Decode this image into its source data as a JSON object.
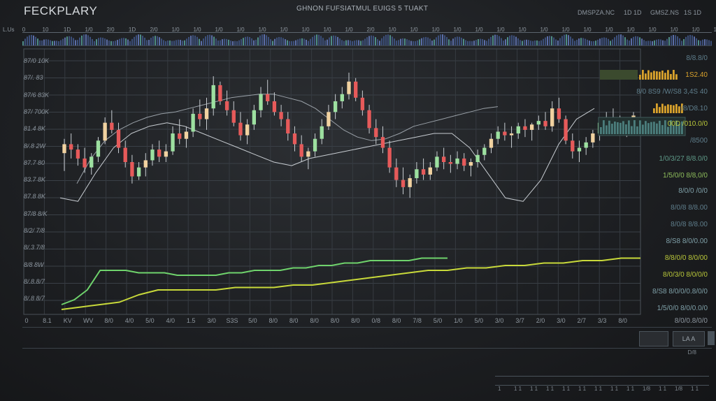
{
  "header": {
    "app_title": "FECKPLARY",
    "chart_title": "GHNON FUFSIATMUL EUIGS 5 TUAKT",
    "buttons": [
      "DMSPZA.NC",
      "1D 1D",
      "GMSZ.NS",
      "1S 1D"
    ],
    "left_tag": "L.Us"
  },
  "ruler_labels": [
    "0",
    "10",
    "1D",
    "1/0",
    "2/0",
    "1D",
    "2/0",
    "1/0",
    "1/0",
    "1/0",
    "1/0",
    "1/0",
    "1/0",
    "1/0",
    "1/0",
    "1/0",
    "2/0",
    "1/0",
    "1/0",
    "1/0",
    "1/0",
    "1/0",
    "1/0",
    "1/0",
    "1/0",
    "1/0",
    "1/0",
    "1/0",
    "1/0",
    "1/0",
    "1/0",
    "1/0",
    "1/0"
  ],
  "y_labels": [
    "87/0 10K",
    "87/. 83",
    "87/6 83K",
    "87/ 700K",
    "81.4 8K",
    "8/.8 2W",
    "87.7 80",
    "83.7 8K",
    "87.8 8K",
    "87/8 8/K",
    "8/2/ 7/8",
    "8/.3 7/8",
    "8/8 8W",
    "8/.8.8/7",
    "8/.8 8/7"
  ],
  "right_labels": [
    "8/8.8/0",
    "1S2.40",
    "8/0 8S9 /W/S8 3,4S 40",
    "/8/D8.10",
    "00D /010.0/0",
    "/8500",
    "1/0/3/27 8/8.0/0",
    "1/5/0/0 8/8,0/0",
    "8/0/0 /0/0",
    "8/0/8 8/8.00",
    "8/0/8 8/8.00",
    "8/S8 8/0/0.00",
    "8/8/0/0 8/0/00",
    "8/0/3/0 8/0/0/0",
    "8/S8 8/0/0/0.8/0/0",
    "1/5/0/0 8/0/0.0/0",
    "8/0/0.8/0/0"
  ],
  "x_labels": [
    "0",
    "8.1",
    "KV",
    "WV",
    "8/0",
    "4/0",
    "5/0",
    "4/0",
    "1.5",
    "3/0",
    "S3S",
    "5/0",
    "8/0",
    "8/0",
    "8/0",
    "8/0",
    "8/0",
    "0/8",
    "8/0",
    "7/8",
    "5/0",
    "1/0",
    "5/0",
    "3/0",
    "3/7",
    "2/0",
    "3/0",
    "2/7",
    "3/3",
    "8/0"
  ],
  "footer": {
    "nav_value": "LA A",
    "small_text": "D/8",
    "tick_numbers": [
      "1",
      "1 1",
      "1 1",
      "1 1",
      "1 1",
      "1 1",
      "1 1",
      "1 1",
      "1 1",
      "1/8",
      "1 1",
      "1/8",
      "1 1"
    ]
  },
  "colors": {
    "bullish": "#9de0a0",
    "bearish": "#e65a5a",
    "neutral": "#f1d2a0",
    "ma_fast": "#c7ccd1",
    "ma_slow": "#9aa1a8",
    "volume_line": "#6fd36c",
    "trend_line": "#c8d93a",
    "accent_bars": "#d9a22c"
  },
  "chart_data": {
    "type": "candlestick",
    "title": "GHNON FUFSIATMUL EUIGS 5 TUAKT",
    "xlabel": "",
    "ylabel": "",
    "ylim": [
      0,
      100
    ],
    "grid": true,
    "ohlc": [
      [
        55,
        63,
        45,
        60
      ],
      [
        60,
        66,
        52,
        57
      ],
      [
        57,
        60,
        48,
        52
      ],
      [
        52,
        58,
        44,
        47
      ],
      [
        47,
        55,
        43,
        53
      ],
      [
        53,
        64,
        50,
        62
      ],
      [
        62,
        75,
        60,
        72
      ],
      [
        72,
        79,
        66,
        68
      ],
      [
        68,
        72,
        55,
        58
      ],
      [
        58,
        62,
        47,
        50
      ],
      [
        50,
        54,
        38,
        42
      ],
      [
        42,
        50,
        40,
        47
      ],
      [
        47,
        55,
        42,
        51
      ],
      [
        51,
        60,
        48,
        57
      ],
      [
        57,
        62,
        50,
        53
      ],
      [
        53,
        60,
        50,
        56
      ],
      [
        56,
        70,
        54,
        66
      ],
      [
        66,
        74,
        60,
        63
      ],
      [
        63,
        70,
        58,
        67
      ],
      [
        67,
        80,
        64,
        77
      ],
      [
        77,
        85,
        70,
        74
      ],
      [
        74,
        86,
        68,
        80
      ],
      [
        80,
        98,
        76,
        93
      ],
      [
        93,
        95,
        82,
        84
      ],
      [
        84,
        90,
        76,
        79
      ],
      [
        79,
        84,
        70,
        72
      ],
      [
        72,
        78,
        62,
        65
      ],
      [
        65,
        74,
        60,
        71
      ],
      [
        71,
        82,
        68,
        79
      ],
      [
        79,
        92,
        75,
        88
      ],
      [
        88,
        96,
        82,
        84
      ],
      [
        84,
        89,
        76,
        78
      ],
      [
        78,
        82,
        70,
        74
      ],
      [
        74,
        78,
        62,
        66
      ],
      [
        66,
        70,
        56,
        60
      ],
      [
        60,
        65,
        50,
        53
      ],
      [
        53,
        58,
        46,
        56
      ],
      [
        56,
        66,
        53,
        63
      ],
      [
        63,
        74,
        60,
        70
      ],
      [
        70,
        82,
        68,
        78
      ],
      [
        78,
        88,
        74,
        84
      ],
      [
        84,
        92,
        80,
        88
      ],
      [
        88,
        100,
        85,
        95
      ],
      [
        95,
        97,
        84,
        86
      ],
      [
        86,
        90,
        76,
        79
      ],
      [
        79,
        82,
        66,
        69
      ],
      [
        69,
        74,
        60,
        64
      ],
      [
        64,
        70,
        55,
        58
      ],
      [
        58,
        62,
        44,
        47
      ],
      [
        47,
        52,
        36,
        40
      ],
      [
        40,
        47,
        32,
        36
      ],
      [
        36,
        43,
        30,
        41
      ],
      [
        41,
        50,
        38,
        46
      ],
      [
        46,
        52,
        40,
        43
      ],
      [
        43,
        50,
        40,
        47
      ],
      [
        47,
        56,
        45,
        53
      ],
      [
        53,
        58,
        46,
        50
      ],
      [
        50,
        54,
        44,
        49
      ],
      [
        49,
        56,
        46,
        52
      ],
      [
        52,
        55,
        45,
        48
      ],
      [
        48,
        52,
        42,
        50
      ],
      [
        50,
        57,
        47,
        54
      ],
      [
        54,
        60,
        51,
        58
      ],
      [
        58,
        66,
        55,
        63
      ],
      [
        63,
        70,
        60,
        67
      ],
      [
        67,
        72,
        62,
        65
      ],
      [
        65,
        70,
        58,
        66
      ],
      [
        66,
        72,
        63,
        70
      ],
      [
        70,
        74,
        64,
        68
      ],
      [
        68,
        72,
        62,
        71
      ],
      [
        71,
        76,
        68,
        73
      ],
      [
        73,
        78,
        68,
        70
      ],
      [
        70,
        84,
        67,
        80
      ],
      [
        80,
        86,
        72,
        74
      ],
      [
        74,
        76,
        60,
        62
      ],
      [
        62,
        66,
        52,
        56
      ],
      [
        56,
        62,
        50,
        58
      ],
      [
        58,
        64,
        54,
        61
      ],
      [
        61,
        68,
        58,
        66
      ],
      [
        66,
        74,
        62,
        72
      ],
      [
        72,
        78,
        68,
        75
      ],
      [
        75,
        80,
        70,
        73
      ],
      [
        73,
        76,
        66,
        70
      ],
      [
        70,
        74,
        64,
        72
      ],
      [
        72,
        78,
        69,
        76
      ]
    ],
    "series": [
      {
        "values": [
          38,
          52,
          62,
          68,
          72,
          75,
          77,
          78,
          80,
          82,
          84,
          86,
          87,
          88,
          88,
          86,
          84,
          80,
          74,
          68,
          64,
          62,
          63,
          66,
          70,
          72,
          74,
          76,
          78,
          80,
          81
        ]
      },
      {
        "values": [
          30,
          28,
          44,
          58,
          66,
          70,
          72,
          70,
          66,
          62,
          58,
          54,
          50,
          48,
          52,
          54,
          56,
          58,
          60,
          62,
          64,
          66,
          66,
          58,
          44,
          30,
          28,
          40,
          60,
          74,
          80
        ]
      },
      {
        "values": [
          4,
          6,
          10,
          18,
          18,
          18,
          17,
          17,
          17,
          16,
          16,
          16,
          16,
          17,
          17,
          18,
          18,
          18,
          19,
          19,
          20,
          20,
          21,
          21,
          22,
          22,
          22,
          22,
          23,
          23,
          23
        ]
      },
      {
        "values": [
          2,
          3,
          4,
          5,
          8,
          10,
          10,
          10,
          10,
          11,
          11,
          11,
          12,
          12,
          13,
          14,
          15,
          16,
          17,
          18,
          18,
          19,
          19,
          20,
          20,
          21,
          21,
          22,
          22,
          23,
          23
        ]
      }
    ]
  }
}
